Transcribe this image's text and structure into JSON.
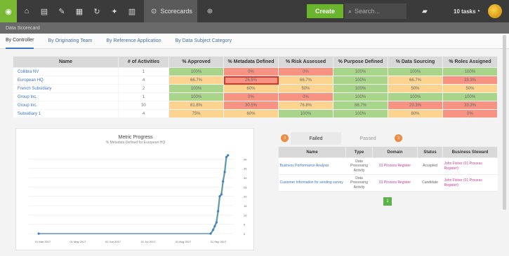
{
  "topbar": {
    "active_tab": "Scorecards",
    "create_label": "Create",
    "search_placeholder": "Search...",
    "tasks_label": "10 tasks"
  },
  "subheader": {
    "text": "Data Scorecard"
  },
  "tabs": [
    {
      "label": "By Controller",
      "active": true
    },
    {
      "label": "By Originating Team",
      "active": false
    },
    {
      "label": "By Reference Application",
      "active": false
    },
    {
      "label": "By Data Subject Category",
      "active": false
    }
  ],
  "table": {
    "columns": [
      "Name",
      "# of Activities",
      "% Approved",
      "% Metadata Defined",
      "% Risk Assessed",
      "% Purpose Defined",
      "% Data Sourcing",
      "% Roles Assigned"
    ],
    "rows": [
      {
        "name": "Collibra NV",
        "activities": "1",
        "cells": [
          [
            "100%",
            "g"
          ],
          [
            "0%",
            "r"
          ],
          [
            "0%",
            "r"
          ],
          [
            "100%",
            "g"
          ],
          [
            "100%",
            "g"
          ],
          [
            "100%",
            "g"
          ]
        ]
      },
      {
        "name": "European HQ",
        "activities": "4",
        "cells": [
          [
            "66.7%",
            "o"
          ],
          [
            "26.6%",
            "r"
          ],
          [
            "66.7%",
            "o"
          ],
          [
            "100%",
            "g"
          ],
          [
            "66.7%",
            "o"
          ],
          [
            "33.3%",
            "r"
          ]
        ]
      },
      {
        "name": "French Subsidiary",
        "activities": "2",
        "cells": [
          [
            "100%",
            "g"
          ],
          [
            "60%",
            "o"
          ],
          [
            "50%",
            "o"
          ],
          [
            "100%",
            "g"
          ],
          [
            "50%",
            "o"
          ],
          [
            "50%",
            "o"
          ]
        ]
      },
      {
        "name": "Group Inc.",
        "activities": "1",
        "cells": [
          [
            "100%",
            "g"
          ],
          [
            "0%",
            "r"
          ],
          [
            "0%",
            "r"
          ],
          [
            "100%",
            "g"
          ],
          [
            "100%",
            "g"
          ],
          [
            "100%",
            "g"
          ]
        ]
      },
      {
        "name": "Group Inc.",
        "activities": "30",
        "cells": [
          [
            "81.8%",
            "o"
          ],
          [
            "30.5%",
            "r"
          ],
          [
            "76.8%",
            "o"
          ],
          [
            "86.7%",
            "g"
          ],
          [
            "23.3%",
            "r"
          ],
          [
            "33.3%",
            "r"
          ]
        ]
      },
      {
        "name": "Subsidiary 1",
        "activities": "4",
        "cells": [
          [
            "75%",
            "o"
          ],
          [
            "60%",
            "o"
          ],
          [
            "100%",
            "g"
          ],
          [
            "100%",
            "g"
          ],
          [
            "80%",
            "o"
          ],
          [
            "0%",
            "r"
          ]
        ]
      }
    ]
  },
  "chart_data": {
    "type": "line",
    "title": "Metric Progress",
    "subtitle": "% Metadata Defined for European HQ",
    "xlabel": "",
    "ylabel": "",
    "x_ticks": [
      "01 Mar 2017",
      "01 May 2017",
      "01 Jun 2017",
      "01 Jul 2017",
      "01 Aug 2017",
      "01 Sep 2017"
    ],
    "y_ticks": [
      0,
      5,
      10,
      15,
      20,
      25,
      30,
      35,
      40
    ],
    "ylim": [
      0,
      45
    ],
    "series": [
      {
        "x": [
          "2017-02-01",
          "2017-08-28",
          "2017-08-31",
          "2017-09-02",
          "2017-09-04",
          "2017-09-06",
          "2017-09-08",
          "2017-09-10",
          "2017-09-12",
          "2017-09-14",
          "2017-09-16",
          "2017-09-18"
        ],
        "y": [
          0,
          0,
          2,
          4,
          6,
          12,
          20,
          21,
          28,
          33,
          41,
          42
        ]
      }
    ],
    "colors": {
      "line": "#5b8fd6",
      "marker": "#3f7fd0",
      "highlight": "#8cc63f"
    }
  },
  "right_panel": {
    "tabs": [
      {
        "label": "Failed",
        "badge": "3",
        "active": true
      },
      {
        "label": "Passed",
        "badge": "3",
        "active": false
      }
    ],
    "columns": [
      "Name",
      "Type",
      "Domain",
      "Status",
      "Business Steward"
    ],
    "rows": [
      {
        "name": "Business Performance Analysis",
        "type": "Data Processing Activity",
        "domain": "01 Process Register",
        "status": "Accepted",
        "steward": "John Fisher (01 Process Register)"
      },
      {
        "name": "Customer Information for sending survey",
        "type": "Data Processing Activity",
        "domain": "01 Process Register",
        "status": "Candidate",
        "steward": "John Fisher (01 Process Register)"
      }
    ],
    "page": "1"
  },
  "colors": {
    "accent": "#78b833",
    "topbar": "#3b3b3b",
    "link": "#3d74c3",
    "good": "#a9d58b",
    "warn": "#fcd48f",
    "bad": "#f79382"
  }
}
